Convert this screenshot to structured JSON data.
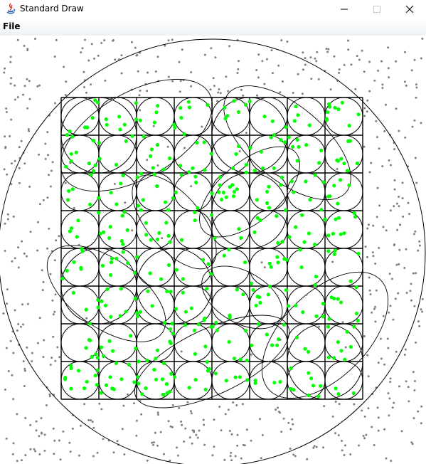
{
  "window": {
    "title": "Standard Draw",
    "icon": "java-icon"
  },
  "menu": {
    "items": [
      {
        "label": "File"
      }
    ]
  },
  "colors": {
    "inside_point": "#00ff00",
    "outside_point": "#808080",
    "stroke": "#000000"
  }
}
